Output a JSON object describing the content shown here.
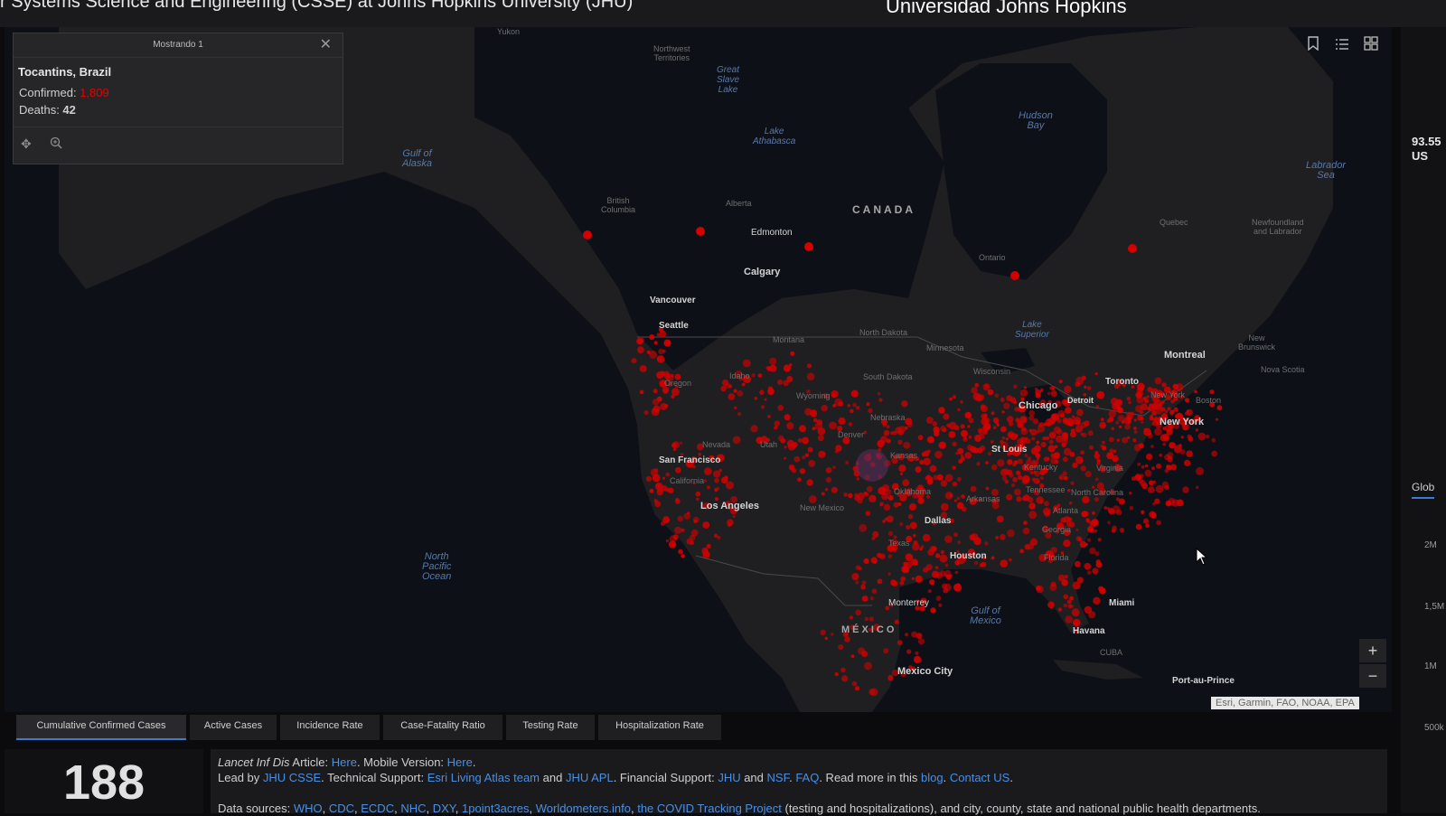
{
  "header": {
    "title": "r Systems Science and Engineering (CSSE) at Johns Hopkins University (JHU)",
    "title_right": "Universidad Johns Hopkins"
  },
  "popup": {
    "header": "Mostrando 1",
    "close_icon": "close-icon",
    "location": "Tocantins, Brazil",
    "confirmed_label": "Confirmed: ",
    "confirmed_value": "1,809",
    "deaths_label": "Deaths: ",
    "deaths_value": "42",
    "pan_icon": "pan-icon",
    "zoom_icon": "zoom-to-icon"
  },
  "map": {
    "widgets": [
      "bookmark-icon",
      "list-icon",
      "basemap-gallery-icon"
    ],
    "zoom_in": "+",
    "zoom_out": "−",
    "attribution": "Esri, Garmin, FAO, NOAA, EPA",
    "labels": {
      "yukon": "Yukon",
      "northwest_territories": "Northwest\nTerritories",
      "great_slave_lake": "Great\nSlave\nLake",
      "lake_athabasca": "Lake\nAthabasca",
      "hudson_bay": "Hudson\nBay",
      "labrador_sea": "Labrador\nSea",
      "gulf_alaska": "Gulf of\nAlaska",
      "british_columbia": "British\nColumbia",
      "alberta": "Alberta",
      "edmonton": "Edmonton",
      "canada": "CANADA",
      "quebec": "Quebec",
      "newfoundland": "Newfoundland\nand Labrador",
      "ontario": "Ontario",
      "calgary": "Calgary",
      "vancouver": "Vancouver",
      "seattle": "Seattle",
      "montana": "Montana",
      "north_dakota": "North Dakota",
      "minnesota": "Minnesota",
      "lake_superior": "Lake\nSuperior",
      "montreal": "Montreal",
      "new_brunswick": "New\nBrunswick",
      "nova_scotia": "Nova Scotia",
      "oregon": "Oregon",
      "idaho": "Idaho",
      "wyoming": "Wyoming",
      "south_dakota": "South Dakota",
      "wisconsin": "Wisconsin",
      "toronto": "Toronto",
      "detroit": "Detroit",
      "chicago": "Chicago",
      "new_york_state": "New York",
      "boston": "Boston",
      "new_york": "New York",
      "nebraska": "Nebraska",
      "denver": "Denver",
      "nevada": "Nevada",
      "utah": "Utah",
      "kansas": "Kansas",
      "st_louis": "St Louis",
      "kentucky": "Kentucky",
      "virginia": "Virginia",
      "san_francisco": "San Francisco",
      "california": "California",
      "oklahoma": "Oklahoma",
      "arkansas": "Arkansas",
      "tennessee": "Tennessee",
      "north_carolina": "North Carolina",
      "los_angeles": "Los Angeles",
      "new_mexico": "New Mexico",
      "dallas": "Dallas",
      "atlanta": "Atlanta",
      "georgia": "Georgia",
      "texas": "Texas",
      "houston": "Houston",
      "florida": "Florida",
      "north_pacific": "North\nPacific\nOcean",
      "monterrey": "Monterrey",
      "gulf_mexico": "Gulf of\nMexico",
      "miami": "Miami",
      "mexico": "MÉXICO",
      "havana": "Havana",
      "cuba": "CUBA",
      "mexico_city": "Mexico City",
      "port_au_prince": "Port-au-Prince"
    }
  },
  "tabs": [
    "Cumulative Confirmed Cases",
    "Active Cases",
    "Incidence Rate",
    "Case-Fatality Ratio",
    "Testing Rate",
    "Hospitalization Rate"
  ],
  "counter": "188",
  "info": {
    "l1_a": "Lancet Inf Dis",
    "l1_b": " Article: ",
    "l1_here1": "Here",
    "l1_c": ". Mobile Version: ",
    "l1_here2": "Here",
    "l1_d": ".",
    "l2_a": "Lead by ",
    "l2_jhucsse": "JHU CSSE",
    "l2_b": ". Technical Support: ",
    "l2_esri": "Esri Living Atlas team",
    "l2_c": " and ",
    "l2_jhuapl": "JHU APL",
    "l2_d": ". Financial Support: ",
    "l2_jhu": "JHU",
    "l2_e": " and ",
    "l2_nsf": "NSF",
    "l2_f": ". ",
    "l2_faq": "FAQ",
    "l2_g": ". Read more in this ",
    "l2_blog": "blog",
    "l2_h": ". ",
    "l2_contact": "Contact US",
    "l2_i": ".",
    "l3_a": "Data sources: ",
    "l3_sources": [
      "WHO",
      "CDC",
      "ECDC",
      "NHC",
      "DXY",
      "1point3acres",
      "Worldometers.info",
      "the COVID Tracking Project"
    ],
    "l3_b": " (testing and hospitalizations), and city, county, state and national public health departments."
  },
  "right_panel": {
    "number": "93.55",
    "sub": "US",
    "tab": "Glob",
    "ticks": [
      "2M",
      "1,5M",
      "1M",
      "500k"
    ]
  },
  "colors": {
    "accent": "#3b7bd4",
    "cases": "#e60000",
    "link": "#4b8fe0"
  }
}
